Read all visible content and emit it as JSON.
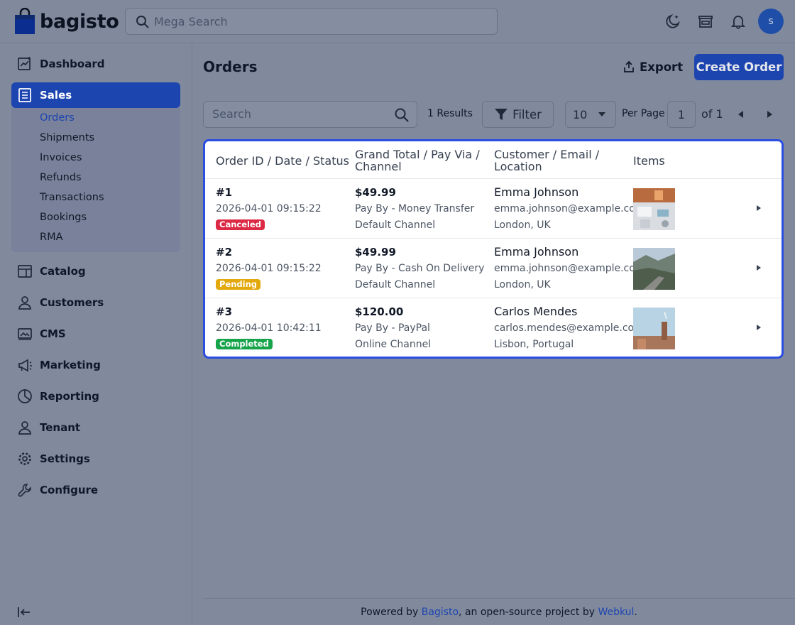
{
  "app": {
    "brand": "bagisto"
  },
  "header": {
    "search_placeholder": "Mega Search",
    "avatar_initial": "s"
  },
  "sidebar": {
    "items": [
      {
        "label": "Dashboard",
        "icon": "dashboard-icon"
      },
      {
        "label": "Sales",
        "icon": "sales-icon",
        "active": true
      },
      {
        "label": "Catalog",
        "icon": "catalog-icon"
      },
      {
        "label": "Customers",
        "icon": "customers-icon"
      },
      {
        "label": "CMS",
        "icon": "cms-icon"
      },
      {
        "label": "Marketing",
        "icon": "marketing-icon"
      },
      {
        "label": "Reporting",
        "icon": "reporting-icon"
      },
      {
        "label": "Tenant",
        "icon": "tenant-icon"
      },
      {
        "label": "Settings",
        "icon": "settings-icon"
      },
      {
        "label": "Configure",
        "icon": "configure-icon"
      }
    ],
    "sales_sub": [
      "Orders",
      "Shipments",
      "Invoices",
      "Refunds",
      "Transactions",
      "Bookings",
      "RMA"
    ]
  },
  "page": {
    "title": "Orders",
    "export_label": "Export",
    "create_label": "Create Order"
  },
  "toolbar": {
    "search_placeholder": "Search",
    "results": "1 Results",
    "filter_label": "Filter",
    "per_page_value": "10",
    "per_page_label": "Per Page",
    "page_value": "1",
    "of_label": "of 1"
  },
  "table": {
    "headers": {
      "col1": "Order ID / Date / Status",
      "col2_line1": "Grand Total / Pay Via /",
      "col2_line2": "Channel",
      "col3_line1": "Customer / Email /",
      "col3_line2": "Location",
      "col4": "Items"
    },
    "rows": [
      {
        "id": "#1",
        "date": "2026-04-01 09:15:22",
        "status": "Canceled",
        "status_color": "#dc2a45",
        "total": "$49.99",
        "pay": "Pay By - Money Transfer",
        "channel": "Default Channel",
        "customer": "Emma Johnson",
        "email": "emma.johnson@example.com",
        "location": "London, UK"
      },
      {
        "id": "#2",
        "date": "2026-04-01 09:15:22",
        "status": "Pending",
        "status_color": "#e3a80c",
        "total": "$49.99",
        "pay": "Pay By - Cash On Delivery",
        "channel": "Default Channel",
        "customer": "Emma Johnson",
        "email": "emma.johnson@example.com",
        "location": "London, UK"
      },
      {
        "id": "#3",
        "date": "2026-04-01 10:42:11",
        "status": "Completed",
        "status_color": "#16a34a",
        "total": "$120.00",
        "pay": "Pay By - PayPal",
        "channel": "Online Channel",
        "customer": "Carlos Mendes",
        "email": "carlos.mendes@example.com",
        "location": "Lisbon, Portugal"
      }
    ]
  },
  "footer": {
    "prefix": "Powered by",
    "link1": "Bagisto",
    "middle": ", an open-source project by",
    "link2": "Webkul",
    "suffix": "."
  },
  "colors": {
    "accent": "#1d45b0",
    "highlight_border": "#2b4de0"
  }
}
